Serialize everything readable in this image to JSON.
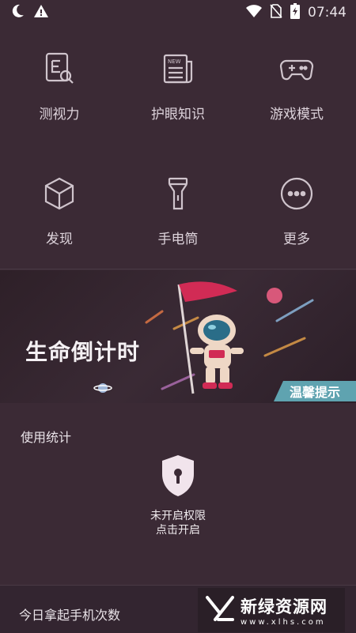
{
  "status_bar": {
    "time": "07:44"
  },
  "grid": [
    {
      "label": "测视力",
      "icon": "eye-test-icon"
    },
    {
      "label": "护眼知识",
      "icon": "news-icon"
    },
    {
      "label": "游戏模式",
      "icon": "gamepad-icon"
    },
    {
      "label": "发现",
      "icon": "cube-icon"
    },
    {
      "label": "手电筒",
      "icon": "flashlight-icon"
    },
    {
      "label": "更多",
      "icon": "more-icon"
    }
  ],
  "banner": {
    "title": "生命倒计时",
    "tag": "温馨提示"
  },
  "usage_stats": {
    "title": "使用统计",
    "lock_line1": "未开启权限",
    "lock_line2": "点击开启"
  },
  "pickups": {
    "title": "今日拿起手机次数"
  },
  "watermark": {
    "main": "新绿资源网",
    "sub": "www.xlhs.com"
  },
  "colors": {
    "background": "#3b2a35",
    "accent_tag": "#5fa3b0",
    "flag": "#d12b55"
  }
}
